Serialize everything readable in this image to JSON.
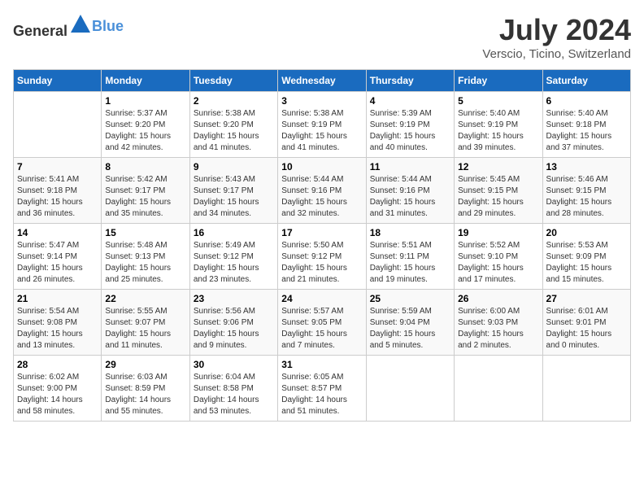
{
  "header": {
    "logo_general": "General",
    "logo_blue": "Blue",
    "month_title": "July 2024",
    "location": "Verscio, Ticino, Switzerland"
  },
  "days_of_week": [
    "Sunday",
    "Monday",
    "Tuesday",
    "Wednesday",
    "Thursday",
    "Friday",
    "Saturday"
  ],
  "weeks": [
    [
      {
        "day": "",
        "sunrise": "",
        "sunset": "",
        "daylight": ""
      },
      {
        "day": "1",
        "sunrise": "Sunrise: 5:37 AM",
        "sunset": "Sunset: 9:20 PM",
        "daylight": "Daylight: 15 hours and 42 minutes."
      },
      {
        "day": "2",
        "sunrise": "Sunrise: 5:38 AM",
        "sunset": "Sunset: 9:20 PM",
        "daylight": "Daylight: 15 hours and 41 minutes."
      },
      {
        "day": "3",
        "sunrise": "Sunrise: 5:38 AM",
        "sunset": "Sunset: 9:19 PM",
        "daylight": "Daylight: 15 hours and 41 minutes."
      },
      {
        "day": "4",
        "sunrise": "Sunrise: 5:39 AM",
        "sunset": "Sunset: 9:19 PM",
        "daylight": "Daylight: 15 hours and 40 minutes."
      },
      {
        "day": "5",
        "sunrise": "Sunrise: 5:40 AM",
        "sunset": "Sunset: 9:19 PM",
        "daylight": "Daylight: 15 hours and 39 minutes."
      },
      {
        "day": "6",
        "sunrise": "Sunrise: 5:40 AM",
        "sunset": "Sunset: 9:18 PM",
        "daylight": "Daylight: 15 hours and 37 minutes."
      }
    ],
    [
      {
        "day": "7",
        "sunrise": "Sunrise: 5:41 AM",
        "sunset": "Sunset: 9:18 PM",
        "daylight": "Daylight: 15 hours and 36 minutes."
      },
      {
        "day": "8",
        "sunrise": "Sunrise: 5:42 AM",
        "sunset": "Sunset: 9:17 PM",
        "daylight": "Daylight: 15 hours and 35 minutes."
      },
      {
        "day": "9",
        "sunrise": "Sunrise: 5:43 AM",
        "sunset": "Sunset: 9:17 PM",
        "daylight": "Daylight: 15 hours and 34 minutes."
      },
      {
        "day": "10",
        "sunrise": "Sunrise: 5:44 AM",
        "sunset": "Sunset: 9:16 PM",
        "daylight": "Daylight: 15 hours and 32 minutes."
      },
      {
        "day": "11",
        "sunrise": "Sunrise: 5:44 AM",
        "sunset": "Sunset: 9:16 PM",
        "daylight": "Daylight: 15 hours and 31 minutes."
      },
      {
        "day": "12",
        "sunrise": "Sunrise: 5:45 AM",
        "sunset": "Sunset: 9:15 PM",
        "daylight": "Daylight: 15 hours and 29 minutes."
      },
      {
        "day": "13",
        "sunrise": "Sunrise: 5:46 AM",
        "sunset": "Sunset: 9:15 PM",
        "daylight": "Daylight: 15 hours and 28 minutes."
      }
    ],
    [
      {
        "day": "14",
        "sunrise": "Sunrise: 5:47 AM",
        "sunset": "Sunset: 9:14 PM",
        "daylight": "Daylight: 15 hours and 26 minutes."
      },
      {
        "day": "15",
        "sunrise": "Sunrise: 5:48 AM",
        "sunset": "Sunset: 9:13 PM",
        "daylight": "Daylight: 15 hours and 25 minutes."
      },
      {
        "day": "16",
        "sunrise": "Sunrise: 5:49 AM",
        "sunset": "Sunset: 9:12 PM",
        "daylight": "Daylight: 15 hours and 23 minutes."
      },
      {
        "day": "17",
        "sunrise": "Sunrise: 5:50 AM",
        "sunset": "Sunset: 9:12 PM",
        "daylight": "Daylight: 15 hours and 21 minutes."
      },
      {
        "day": "18",
        "sunrise": "Sunrise: 5:51 AM",
        "sunset": "Sunset: 9:11 PM",
        "daylight": "Daylight: 15 hours and 19 minutes."
      },
      {
        "day": "19",
        "sunrise": "Sunrise: 5:52 AM",
        "sunset": "Sunset: 9:10 PM",
        "daylight": "Daylight: 15 hours and 17 minutes."
      },
      {
        "day": "20",
        "sunrise": "Sunrise: 5:53 AM",
        "sunset": "Sunset: 9:09 PM",
        "daylight": "Daylight: 15 hours and 15 minutes."
      }
    ],
    [
      {
        "day": "21",
        "sunrise": "Sunrise: 5:54 AM",
        "sunset": "Sunset: 9:08 PM",
        "daylight": "Daylight: 15 hours and 13 minutes."
      },
      {
        "day": "22",
        "sunrise": "Sunrise: 5:55 AM",
        "sunset": "Sunset: 9:07 PM",
        "daylight": "Daylight: 15 hours and 11 minutes."
      },
      {
        "day": "23",
        "sunrise": "Sunrise: 5:56 AM",
        "sunset": "Sunset: 9:06 PM",
        "daylight": "Daylight: 15 hours and 9 minutes."
      },
      {
        "day": "24",
        "sunrise": "Sunrise: 5:57 AM",
        "sunset": "Sunset: 9:05 PM",
        "daylight": "Daylight: 15 hours and 7 minutes."
      },
      {
        "day": "25",
        "sunrise": "Sunrise: 5:59 AM",
        "sunset": "Sunset: 9:04 PM",
        "daylight": "Daylight: 15 hours and 5 minutes."
      },
      {
        "day": "26",
        "sunrise": "Sunrise: 6:00 AM",
        "sunset": "Sunset: 9:03 PM",
        "daylight": "Daylight: 15 hours and 2 minutes."
      },
      {
        "day": "27",
        "sunrise": "Sunrise: 6:01 AM",
        "sunset": "Sunset: 9:01 PM",
        "daylight": "Daylight: 15 hours and 0 minutes."
      }
    ],
    [
      {
        "day": "28",
        "sunrise": "Sunrise: 6:02 AM",
        "sunset": "Sunset: 9:00 PM",
        "daylight": "Daylight: 14 hours and 58 minutes."
      },
      {
        "day": "29",
        "sunrise": "Sunrise: 6:03 AM",
        "sunset": "Sunset: 8:59 PM",
        "daylight": "Daylight: 14 hours and 55 minutes."
      },
      {
        "day": "30",
        "sunrise": "Sunrise: 6:04 AM",
        "sunset": "Sunset: 8:58 PM",
        "daylight": "Daylight: 14 hours and 53 minutes."
      },
      {
        "day": "31",
        "sunrise": "Sunrise: 6:05 AM",
        "sunset": "Sunset: 8:57 PM",
        "daylight": "Daylight: 14 hours and 51 minutes."
      },
      {
        "day": "",
        "sunrise": "",
        "sunset": "",
        "daylight": ""
      },
      {
        "day": "",
        "sunrise": "",
        "sunset": "",
        "daylight": ""
      },
      {
        "day": "",
        "sunrise": "",
        "sunset": "",
        "daylight": ""
      }
    ]
  ]
}
